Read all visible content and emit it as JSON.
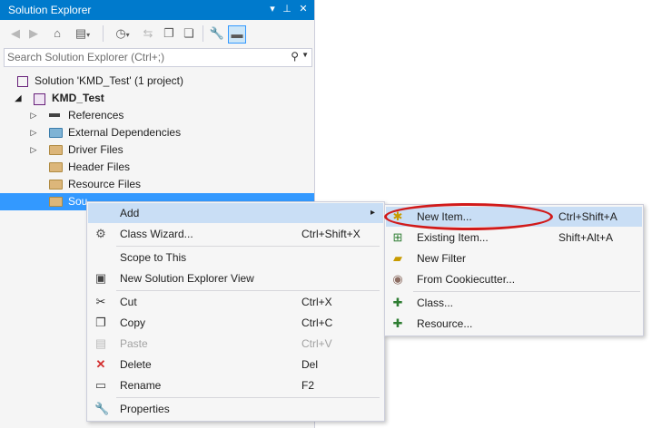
{
  "panel": {
    "title": "Solution Explorer",
    "title_buttons": {
      "dropdown": "▾",
      "pin": "⊥",
      "close": "✕"
    }
  },
  "toolbar": {
    "icons": [
      "back-icon",
      "forward-icon",
      "home-icon",
      "switch-views-icon",
      "history-icon",
      "sync-icon",
      "collapse-all-icon",
      "show-all-files-icon",
      "properties-icon",
      "preview-icon"
    ]
  },
  "search": {
    "placeholder": "Search Solution Explorer (Ctrl+;)",
    "value": ""
  },
  "tree": {
    "solution": "Solution 'KMD_Test' (1 project)",
    "project": "KMD_Test",
    "references": "References",
    "external_dependencies": "External Dependencies",
    "driver_files": "Driver Files",
    "header_files": "Header Files",
    "resource_files": "Resource Files",
    "source_files": "Source Files",
    "source_files_visible": "Sou"
  },
  "context_menu": {
    "add": {
      "label": "Add",
      "arrow": "▸"
    },
    "class_wizard": {
      "label": "Class Wizard...",
      "shortcut": "Ctrl+Shift+X"
    },
    "scope_to_this": {
      "label": "Scope to This"
    },
    "new_view": {
      "label": "New Solution Explorer View"
    },
    "cut": {
      "label": "Cut",
      "shortcut": "Ctrl+X"
    },
    "copy": {
      "label": "Copy",
      "shortcut": "Ctrl+C"
    },
    "paste": {
      "label": "Paste",
      "shortcut": "Ctrl+V"
    },
    "delete": {
      "label": "Delete",
      "shortcut": "Del"
    },
    "rename": {
      "label": "Rename",
      "shortcut": "F2"
    },
    "properties": {
      "label": "Properties"
    }
  },
  "add_submenu": {
    "new_item": {
      "label": "New Item...",
      "shortcut": "Ctrl+Shift+A"
    },
    "existing_item": {
      "label": "Existing Item...",
      "shortcut": "Shift+Alt+A"
    },
    "new_filter": {
      "label": "New Filter"
    },
    "from_cookiecutter": {
      "label": "From Cookiecutter..."
    },
    "class": {
      "label": "Class..."
    },
    "resource": {
      "label": "Resource..."
    }
  },
  "colors": {
    "accent": "#007acc",
    "selection": "#3399ff",
    "highlight": "#c9def5",
    "annotation": "#d11a1a"
  }
}
